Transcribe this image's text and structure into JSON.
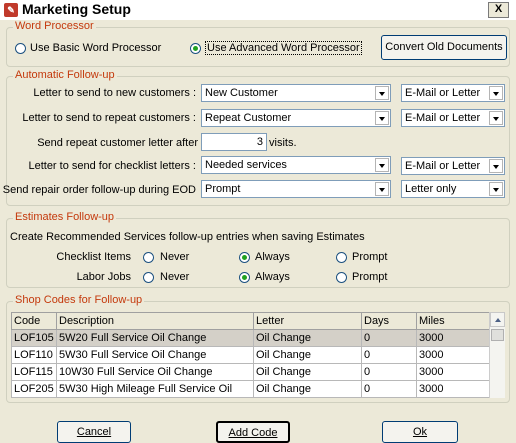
{
  "window": {
    "title": "Marketing Setup",
    "close_label": "X"
  },
  "word_processor": {
    "legend": "Word Processor",
    "basic_label": "Use Basic Word Processor",
    "advanced_label": "Use Advanced Word Processor",
    "convert_button": "Convert Old Documents"
  },
  "follow_up": {
    "legend": "Automatic Follow-up",
    "new_label": "Letter to send to new customers :",
    "new_value": "New Customer",
    "new_method": "E-Mail or Letter",
    "repeat_label": "Letter to send to repeat customers :",
    "repeat_value": "Repeat Customer",
    "repeat_method": "E-Mail or Letter",
    "after_label": "Send repeat customer letter after",
    "after_value": "3",
    "after_unit": "visits.",
    "checklist_label": "Letter to send for checklist letters :",
    "checklist_value": "Needed services",
    "checklist_method": "E-Mail or Letter",
    "repair_label": "Send repair order follow-up during EOD",
    "repair_value": "Prompt",
    "repair_method": "Letter only"
  },
  "estimates": {
    "legend": "Estimates Follow-up",
    "description": "Create Recommended Services follow-up entries when saving Estimates",
    "checklist_label": "Checklist Items",
    "labor_label": "Labor Jobs",
    "never": "Never",
    "always": "Always",
    "prompt": "Prompt"
  },
  "shop_codes": {
    "legend": "Shop Codes for Follow-up",
    "columns": [
      "Code",
      "Description",
      "Letter",
      "Days",
      "Miles"
    ],
    "rows": [
      [
        "LOF105",
        "5W20 Full Service Oil Change",
        "Oil Change",
        "0",
        "3000"
      ],
      [
        "LOF110",
        "5W30 Full Service Oil Change",
        "Oil Change",
        "0",
        "3000"
      ],
      [
        "LOF115",
        "10W30 Full Service Oil Change",
        "Oil Change",
        "0",
        "3000"
      ],
      [
        "LOF205",
        "5W30 High Mileage Full Service Oil",
        "Oil Change",
        "0",
        "3000"
      ]
    ]
  },
  "buttons": {
    "cancel": "Cancel",
    "add_code": "Add Code",
    "ok": "Ok"
  }
}
